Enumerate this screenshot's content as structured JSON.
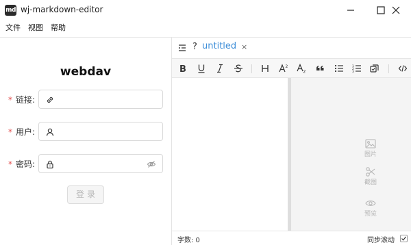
{
  "window": {
    "icon_text": "md",
    "title": "wj-markdown-editor"
  },
  "menu": {
    "items": [
      "文件",
      "视图",
      "帮助"
    ]
  },
  "login": {
    "title": "webdav",
    "required_mark": "*",
    "fields": [
      {
        "label": "链接",
        "colon": ":",
        "value": "",
        "prefix_icon": "link-icon"
      },
      {
        "label": "用户",
        "colon": ":",
        "value": "",
        "prefix_icon": "user-icon"
      },
      {
        "label": "密码",
        "colon": ":",
        "value": "",
        "prefix_icon": "lock-icon",
        "suffix_icon": "eye-slash-icon"
      }
    ],
    "submit_label": "登录"
  },
  "tab": {
    "question_mark": "?",
    "name": "untitled",
    "close": "×"
  },
  "toolbar": {
    "buttons": [
      "bold-icon",
      "underline-icon",
      "italic-icon",
      "strikethrough-icon",
      "heading-icon",
      "superscript-icon",
      "subscript-icon",
      "quote-icon",
      "unordered-list-icon",
      "ordered-list-icon",
      "task-list-icon",
      "code-icon"
    ]
  },
  "float_tools": {
    "image_label": "图片",
    "screenshot_label": "截图",
    "preview_label": "预览"
  },
  "status": {
    "wordcount": "字数: 0",
    "sync_scroll": "同步滚动",
    "sync_checked": true
  },
  "colors": {
    "accent": "#3e8ed8",
    "required": "#e34d4d"
  }
}
